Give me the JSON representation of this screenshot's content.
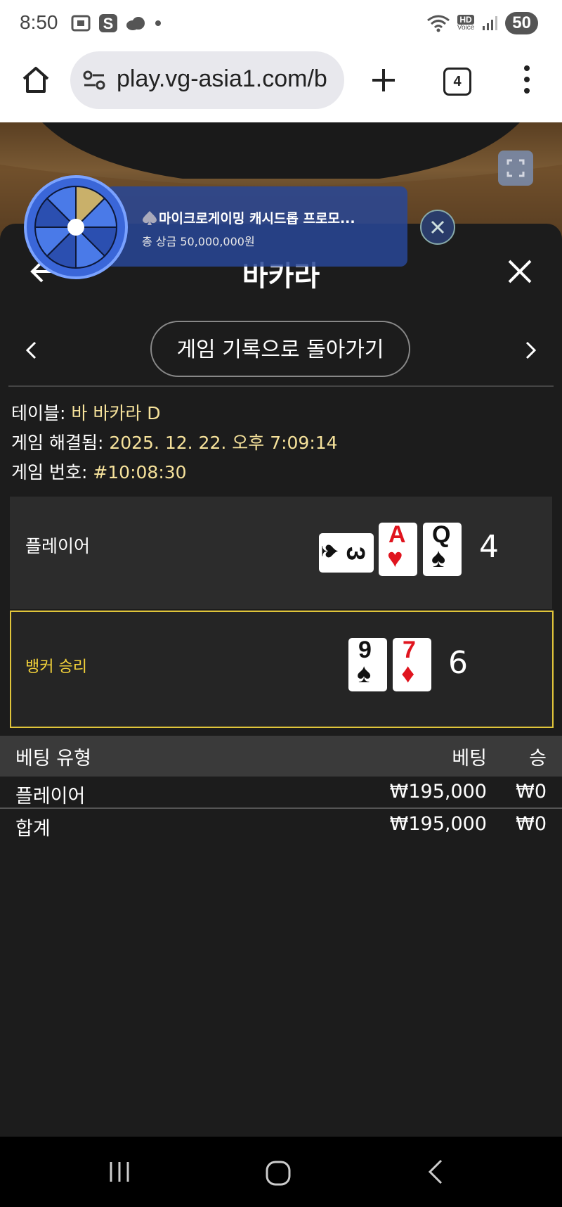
{
  "status_bar": {
    "time": "8:50",
    "battery": "50",
    "hd_label": "HD",
    "voice_label": "Voice"
  },
  "browser": {
    "url": "play.vg-asia1.com/b",
    "tab_count": "4"
  },
  "promo": {
    "title": "마이크로게이밍 캐시드롭 프로모...",
    "subtitle": "총 상금 50,000,000원"
  },
  "header": {
    "title": "바카라"
  },
  "nav": {
    "back_to_history": "게임 기록으로 돌아가기"
  },
  "info": {
    "table_label": "테이블: ",
    "table_value": "바 바카라 D",
    "resolved_label": "게임 해결됨: ",
    "resolved_value": "2025. 12. 22. 오후 7:09:14",
    "game_no_label": "게임 번호: ",
    "game_no_value": "#10:08:30"
  },
  "player": {
    "label": "플레이어",
    "score": "4",
    "cards": [
      {
        "rank": "3",
        "suit": "♠",
        "color": "#111111",
        "rotated": true
      },
      {
        "rank": "A",
        "suit": "♥",
        "color": "#e0141e",
        "rotated": false
      },
      {
        "rank": "Q",
        "suit": "♠",
        "color": "#111111",
        "rotated": false
      }
    ]
  },
  "banker": {
    "label": "뱅커 승리",
    "score": "6",
    "cards": [
      {
        "rank": "9",
        "suit": "♠",
        "color": "#111111"
      },
      {
        "rank": "7",
        "suit": "♦",
        "color": "#e0141e"
      }
    ]
  },
  "bets": {
    "headers": {
      "type": "베팅 유형",
      "bet": "베팅",
      "win": "승"
    },
    "rows": [
      {
        "type": "플레이어",
        "bet": "₩195,000",
        "win": "₩0"
      }
    ],
    "total": {
      "label": "합계",
      "bet": "₩195,000",
      "win": "₩0"
    }
  },
  "colors": {
    "accent_gold": "#e0c53a",
    "info_value": "#f6e29b",
    "panel_bg": "#1c1c1c"
  }
}
